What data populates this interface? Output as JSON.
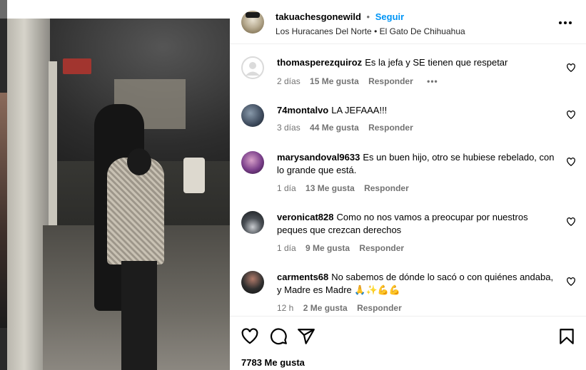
{
  "post": {
    "username": "takuachesgonewild",
    "separator": "•",
    "follow_label": "Seguir",
    "music": "Los Huracanes Del Norte • El Gato De Chihuahua",
    "more_icon": "more-options-icon"
  },
  "comments": [
    {
      "user": "thomasperezquiroz",
      "text": "Es la jefa y SE tienen que respetar",
      "time": "2 días",
      "likes": "15 Me gusta",
      "reply": "Responder",
      "extra": "•••",
      "avatar_color": "#dbdbdb"
    },
    {
      "user": "74montalvo",
      "text": "LA JEFAAA!!!",
      "time": "3 días",
      "likes": "44 Me gusta",
      "reply": "Responder",
      "avatar_color": "#3d4a5c"
    },
    {
      "user": "marysandoval9633",
      "text": "Es un buen hijo, otro se hubiese rebelado, con lo grande que está.",
      "time": "1 día",
      "likes": "13 Me gusta",
      "reply": "Responder",
      "avatar_color": "#7a3f8a"
    },
    {
      "user": "veronicat828",
      "text": "Como no nos vamos a preocupar por nuestros peques que crezcan derechos",
      "time": "1 día",
      "likes": "9 Me gusta",
      "reply": "Responder",
      "avatar_color": "#4a4f55"
    },
    {
      "user": "carments68",
      "text": "No sabemos de dónde lo sacó o con quiénes andaba, y Madre es Madre 🙏✨💪💪",
      "time": "12 h",
      "likes": "2 Me gusta",
      "reply": "Responder",
      "avatar_color": "#2f2f2f"
    }
  ],
  "actions": {
    "icons": [
      "heart-icon",
      "comment-icon",
      "share-icon",
      "bookmark-icon"
    ],
    "likes_count": "7783 Me gusta"
  },
  "colors": {
    "accent": "#0095f6",
    "muted": "#737373",
    "divider": "#efefef"
  }
}
